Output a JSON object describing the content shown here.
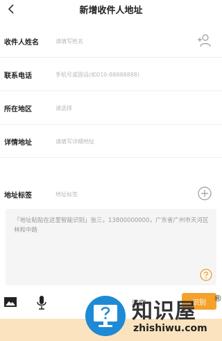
{
  "header": {
    "title": "新增收件人地址",
    "back_icon": "chevron-left-icon"
  },
  "form": {
    "name": {
      "label": "收件人姓名",
      "placeholder": "请填写姓名",
      "icon": "add-contact-icon"
    },
    "phone": {
      "label": "联系电话",
      "placeholder": "手机号或固话(如010-88888888)"
    },
    "region": {
      "label": "所在地区",
      "placeholder": "请选择"
    },
    "detail": {
      "label": "详情地址",
      "placeholder": "请填写详细地址"
    },
    "tag": {
      "label": "地址标签",
      "placeholder": "地址标签",
      "icon": "plus-circle-icon"
    }
  },
  "paste": {
    "text": "「地址粘贴在这里智能识别」张三，13800000000，广东省广州市天河区林和中路",
    "help_icon": "question-circle-icon"
  },
  "toolbar": {
    "image_icon": "image-icon",
    "mic_icon": "microphone-icon",
    "clear_label": "清空",
    "identify_label": "识别"
  },
  "watermark": {
    "name": "知识屋",
    "registered": "®",
    "domain": "zhishiwu.com"
  },
  "colors": {
    "accent": "#f5a12a",
    "icon_gray": "#999999",
    "help_orange": "#f0a020"
  }
}
